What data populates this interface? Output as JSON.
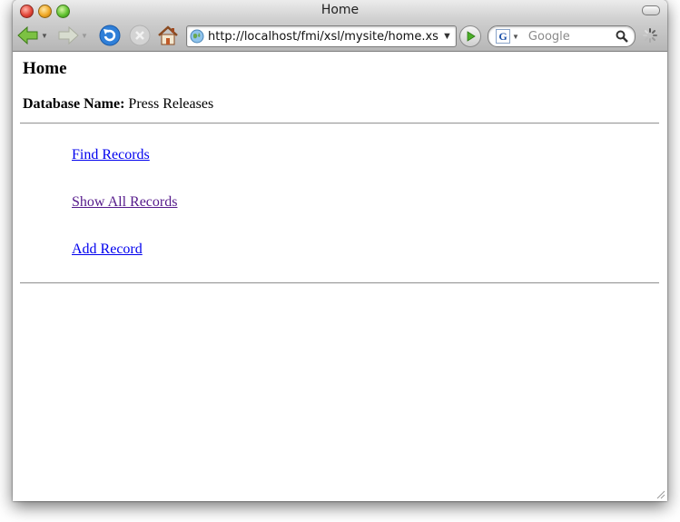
{
  "window": {
    "title": "Home"
  },
  "toolbar": {
    "url": "http://localhost/fmi/xsl/mysite/home.xsl;jse",
    "search_placeholder": "Google",
    "search_engine_glyph": "G",
    "icons": [
      "back-icon",
      "forward-icon",
      "reload-icon",
      "stop-icon",
      "home-icon",
      "globe-icon",
      "go-icon",
      "search-icon",
      "loading-spinner-icon"
    ]
  },
  "page": {
    "heading": "Home",
    "db_label": "Database Name:",
    "db_value": "Press Releases",
    "links": {
      "find": "Find Records",
      "show_all": "Show All Records",
      "add": "Add Record"
    }
  },
  "colors": {
    "link": "#0000ee",
    "visited_link": "#551a8b"
  }
}
